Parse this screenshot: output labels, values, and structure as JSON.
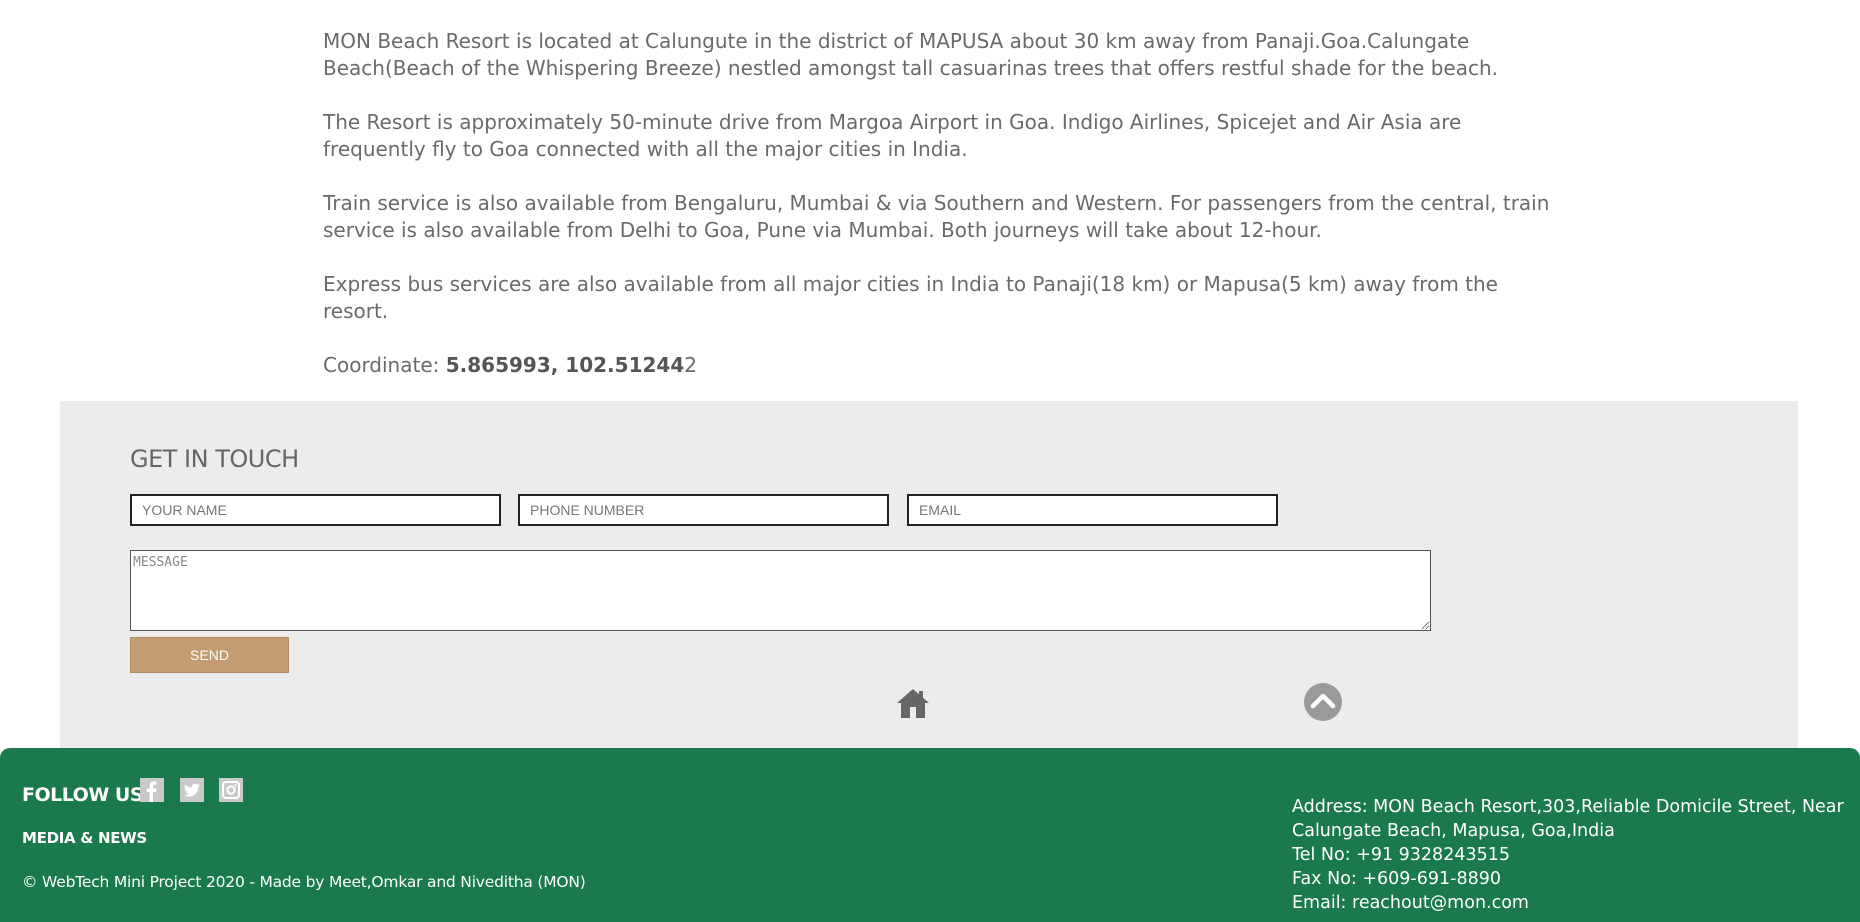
{
  "about": {
    "p1": "MON Beach Resort is located at Calungute in the district of MAPUSA about 30 km away from Panaji.Goa.Calungate Beach(Beach of the Whispering Breeze) nestled amongst tall casuarinas trees that offers restful shade for the beach.",
    "p2": "The Resort is approximately 50-minute drive from Margoa Airport in Goa. Indigo Airlines, Spicejet and Air Asia are frequently fly to Goa connected with all the major cities in India.",
    "p3": "Train service is also available from Bengaluru, Mumbai & via Southern and Western. For passengers from the central, train service is also available from Delhi to Goa, Pune via Mumbai. Both journeys will take about 12-hour.",
    "p4": "Express bus services are also available from all major cities in India to Panaji(18 km) or Mapusa(5 km) away from the resort.",
    "coord_label": "Coordinate: ",
    "coord_bold": "5.865993, 102.51244",
    "coord_tail": "2"
  },
  "contact": {
    "heading": "GET IN TOUCH",
    "name_placeholder": "YOUR NAME",
    "phone_placeholder": "PHONE NUMBER",
    "email_placeholder": "EMAIL",
    "message_placeholder": "MESSAGE",
    "send_label": "SEND",
    "home_icon": "home-icon",
    "top_icon": "chevron-up-circle-icon"
  },
  "footer": {
    "follow_label": "FOLLOW US",
    "social": [
      "facebook-icon",
      "twitter-icon",
      "instagram-icon"
    ],
    "media_label": "MEDIA & NEWS",
    "copyright": "© WebTech Mini Project 2020 - Made by Meet,Omkar and Niveditha (MON)",
    "address_line1": "Address: MON Beach Resort,303,Reliable Domicile Street, Near Calungate Beach, Mapusa, Goa,India",
    "tel": "Tel No: +91 9328243515",
    "fax": "Fax No: +609-691-8890",
    "email": "Email: reachout@mon.com"
  },
  "colors": {
    "footer_bg": "#1a7a4b",
    "contact_bg": "#ececec",
    "send_bg": "#c49c72"
  }
}
